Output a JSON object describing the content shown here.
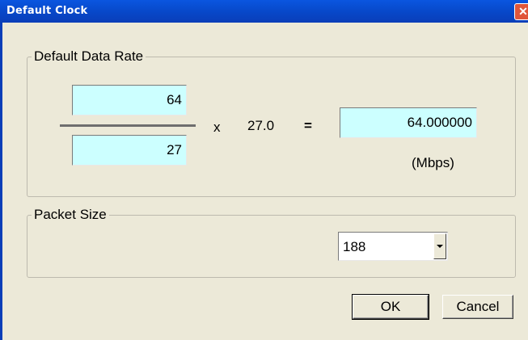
{
  "window": {
    "title": "Default Clock",
    "close_label": "✕"
  },
  "data_rate": {
    "group_label": "Default Data Rate",
    "numerator": "64",
    "denominator": "27",
    "multiply_sign": "x",
    "multiplier": "27.0",
    "equals_sign": "=",
    "result": "64.000000",
    "unit": "(Mbps)"
  },
  "packet_size": {
    "group_label": "Packet Size",
    "selected": "188"
  },
  "buttons": {
    "ok": "OK",
    "cancel": "Cancel"
  },
  "icons": {
    "close": "close-icon",
    "dropdown": "chevron-down-icon"
  },
  "colors": {
    "titlebar": "#0A56E0",
    "field_background": "#CCFFFF",
    "dialog_background": "#ECE9D8",
    "close_button": "#E0563A"
  }
}
